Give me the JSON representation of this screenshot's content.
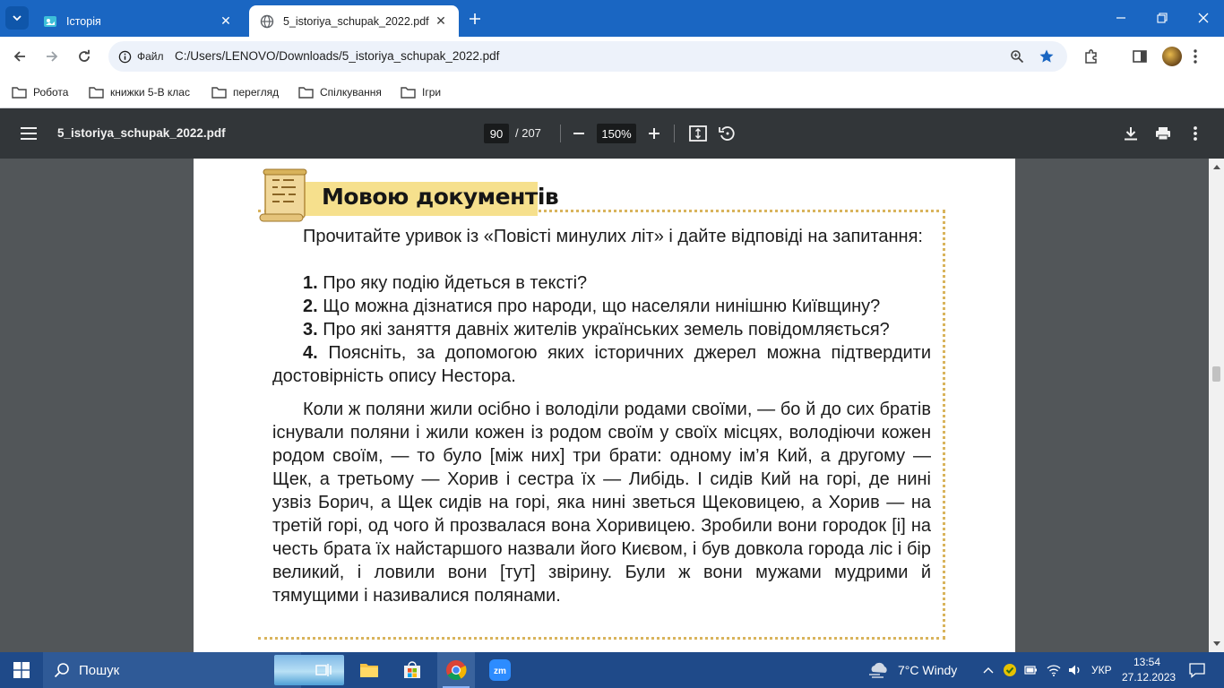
{
  "browser": {
    "tabs": [
      {
        "title": "Історія",
        "active": false
      },
      {
        "title": "5_istoriya_schupak_2022.pdf",
        "active": true
      }
    ],
    "omnibox": {
      "chip_label": "Файл",
      "url": "C:/Users/LENOVO/Downloads/5_istoriya_schupak_2022.pdf"
    },
    "bookmarks": [
      "Робота",
      "книжки 5-В клас",
      "перегляд",
      "Спілкування",
      "Ігри"
    ]
  },
  "pdf_viewer": {
    "file_name": "5_istoriya_schupak_2022.pdf",
    "current_page": "90",
    "total_pages": "/ 207",
    "zoom": "150%"
  },
  "page_content": {
    "section_title": "Мовою документів",
    "intro": "Прочитайте уривок із «Повісті минулих літ» і дайте відповіді на запитання:",
    "questions": [
      {
        "num": "1.",
        "text": " Про яку подію йдеться в тексті?"
      },
      {
        "num": "2.",
        "text": " Що можна дізнатися про народи, що населяли нинішню Київщину?"
      },
      {
        "num": "3.",
        "text": " Про які заняття давніх жителів українських земель повідомляється?"
      },
      {
        "num": "4.",
        "text": " Поясніть, за допомогою яких історичних джерел можна підтвердити достовірність опису Нестора."
      }
    ],
    "excerpt": "Коли ж поляни жили осібно і володіли родами своїми, — бо й до сих братів існували поляни і жили кожен із родом своїм у своїх місцях, володіючи кожен родом своїм, — то було [між них] три брати: одному ім’я Кий, а другому — Щек, а третьому — Хорив і сестра їх — Либідь. І сидів Кий на горі, де нині узвіз Борич, а Щек сидів на горі, яка нині зветься Щековицею, а Хорив — на третій горі, од чого й прозвалася вона Хоривицею. Зробили вони городок [і] на честь брата їх найстаршого назвали його Києвом, і був довкола города ліс і бір великий, і ловили вони [тут] звірину. Були ж вони мужами мудрими й тямущими і називалися полянами."
  },
  "taskbar": {
    "search_label": "Пошук",
    "weather": "7°C  Windy",
    "language": "УКР",
    "time": "13:54",
    "date": "27.12.2023"
  },
  "colors": {
    "tab_strip": "#1a66c2",
    "pdf_toolbar": "#323639",
    "viewer_bg": "#525659",
    "banner": "#f6e08d",
    "dotted_border": "#d9b45c",
    "taskbar": "#1f4a89"
  }
}
